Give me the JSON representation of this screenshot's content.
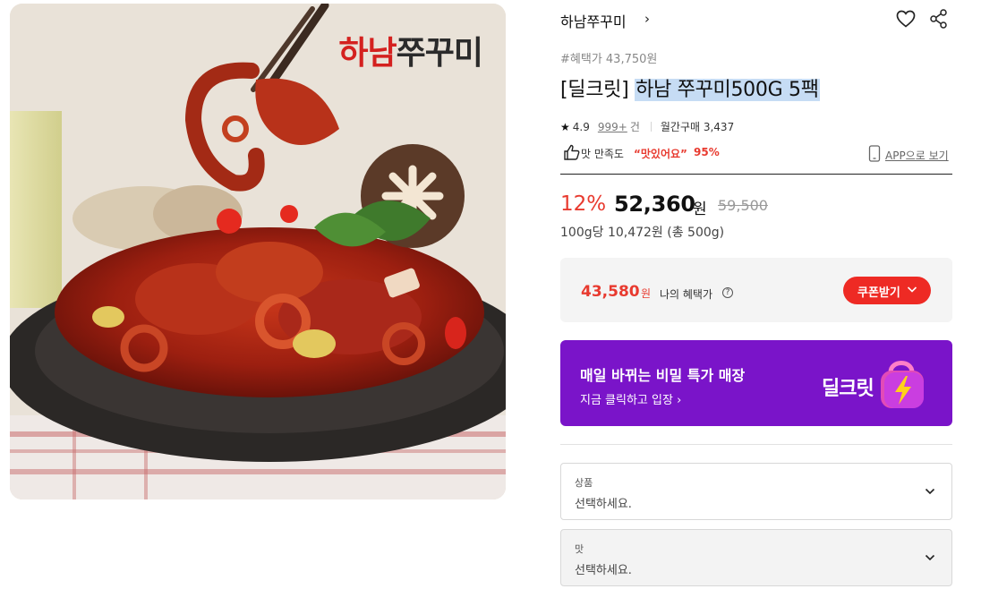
{
  "image": {
    "brand_logo_red": "하남",
    "brand_logo_dark": "쭈꾸미"
  },
  "store": {
    "name": "하남쭈꾸미",
    "chevron": "›"
  },
  "benefit_tag": "#혜택가 43,750원",
  "title": {
    "prefix": "[딜크릿]",
    "highlighted": "하남 쭈꾸미500G 5팩"
  },
  "rating": {
    "value": "4.9",
    "review_count": "999+",
    "review_unit": "건",
    "monthly_sales": "월간구매 3,437"
  },
  "taste": {
    "label": "맛 만족도",
    "quote": "“맛있어요”",
    "percent": "95%"
  },
  "app_link": "APP으로 보기",
  "price": {
    "discount": "12%",
    "amount": "52,360",
    "currency": "원",
    "original": "59,500",
    "unit_price": "100g당 10,472원 (총 500g)"
  },
  "benefit": {
    "price": "43,580",
    "currency": "원",
    "label": "나의 혜택가",
    "question_mark": "?",
    "coupon_button": "쿠폰받기"
  },
  "banner": {
    "title": "매일 바뀌는 비밀 특가 매장",
    "subtitle": "지금 클릭하고 입장 ›",
    "logo_text": "딜크릿"
  },
  "options": [
    {
      "label": "상품",
      "value": "선택하세요."
    },
    {
      "label": "맛",
      "value": "선택하세요."
    }
  ],
  "colors": {
    "accent_red": "#e83a2f",
    "coupon_red": "#ee2a24",
    "banner_purple": "#7a14c9",
    "highlight_blue": "#c6dcf4"
  }
}
